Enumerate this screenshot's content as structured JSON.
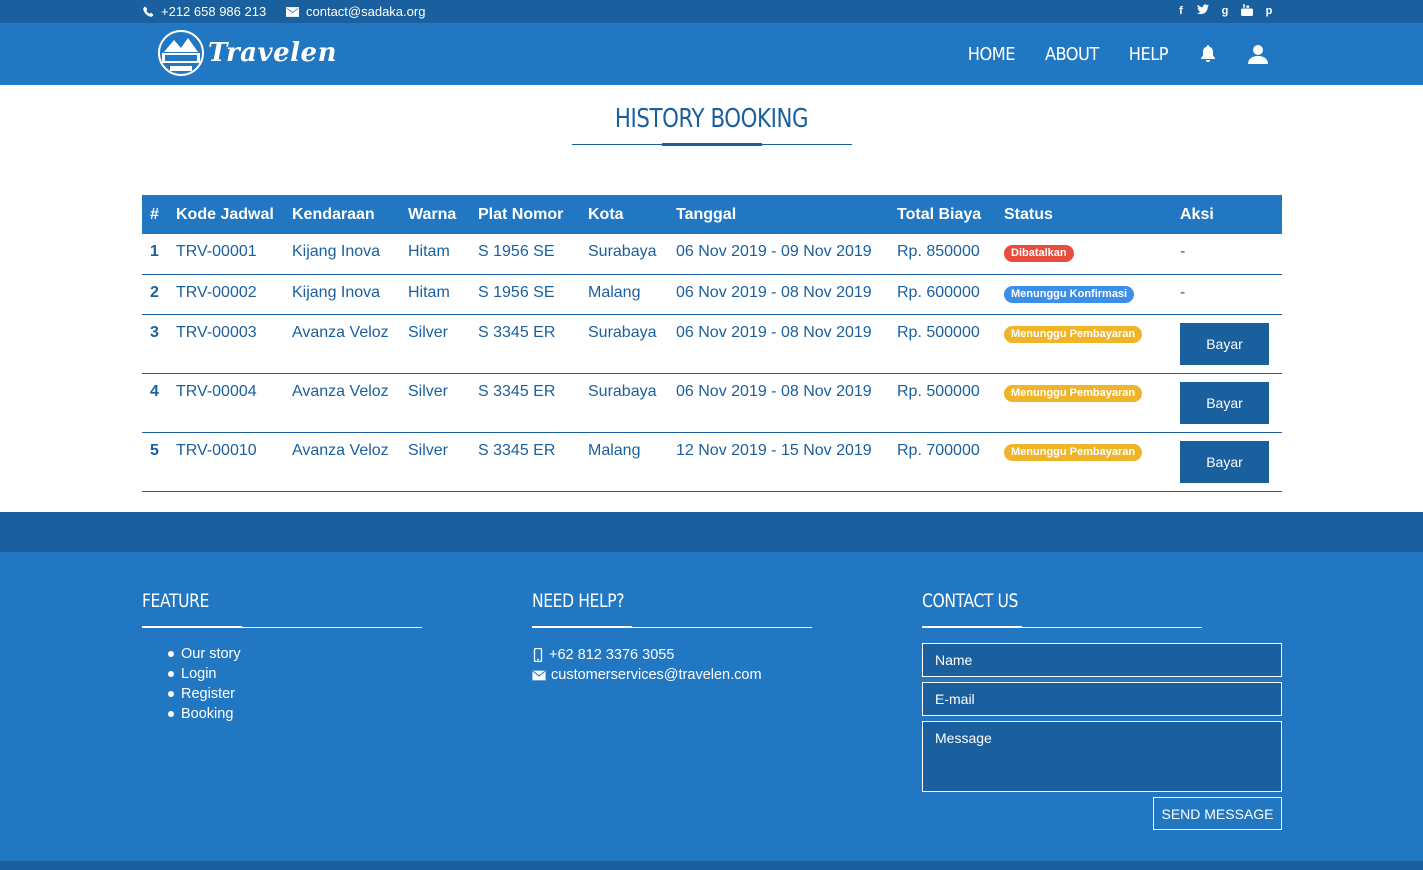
{
  "topbar": {
    "phone": "+212 658 986 213",
    "email": "contact@sadaka.org",
    "social": [
      "facebook-icon",
      "twitter-icon",
      "google-plus-icon",
      "youtube-icon",
      "pinterest-icon"
    ]
  },
  "navbar": {
    "brand": "Travelen",
    "links": [
      "HOME",
      "ABOUT",
      "HELP"
    ],
    "icons": [
      "bell-icon",
      "user-icon"
    ]
  },
  "page": {
    "title": "HISTORY BOOKING"
  },
  "table": {
    "headers": [
      "#",
      "Kode Jadwal",
      "Kendaraan",
      "Warna",
      "Plat Nomor",
      "Kota",
      "Tanggal",
      "Total Biaya",
      "Status",
      "Aksi"
    ],
    "rows": [
      {
        "num": "1",
        "kode": "TRV-00001",
        "kendaraan": "Kijang Inova",
        "warna": "Hitam",
        "plat": "S 1956 SE",
        "kota": "Surabaya",
        "tanggal": "06 Nov 2019 - 09 Nov 2019",
        "biaya": "Rp. 850000",
        "status": "Dibatalkan",
        "aksi": "-"
      },
      {
        "num": "2",
        "kode": "TRV-00002",
        "kendaraan": "Kijang Inova",
        "warna": "Hitam",
        "plat": "S 1956 SE",
        "kota": "Malang",
        "tanggal": "06 Nov 2019 - 08 Nov 2019",
        "biaya": "Rp. 600000",
        "status": "Menunggu Konfirmasi",
        "aksi": "-"
      },
      {
        "num": "3",
        "kode": "TRV-00003",
        "kendaraan": "Avanza Veloz",
        "warna": "Silver",
        "plat": "S 3345 ER",
        "kota": "Surabaya",
        "tanggal": "06 Nov 2019 - 08 Nov 2019",
        "biaya": "Rp. 500000",
        "status": "Menunggu Pembayaran",
        "aksi": "Bayar"
      },
      {
        "num": "4",
        "kode": "TRV-00004",
        "kendaraan": "Avanza Veloz",
        "warna": "Silver",
        "plat": "S 3345 ER",
        "kota": "Surabaya",
        "tanggal": "06 Nov 2019 - 08 Nov 2019",
        "biaya": "Rp. 500000",
        "status": "Menunggu Pembayaran",
        "aksi": "Bayar"
      },
      {
        "num": "5",
        "kode": "TRV-00010",
        "kendaraan": "Avanza Veloz",
        "warna": "Silver",
        "plat": "S 3345 ER",
        "kota": "Malang",
        "tanggal": "12 Nov 2019 - 15 Nov 2019",
        "biaya": "Rp. 700000",
        "status": "Menunggu Pembayaran",
        "aksi": "Bayar"
      }
    ]
  },
  "footer": {
    "feature": {
      "title": "FEATURE",
      "items": [
        "Our story",
        "Login",
        "Register",
        "Booking"
      ]
    },
    "help": {
      "title": "NEED HELP?",
      "phone": "+62 812 3376 3055",
      "email": "customerservices@travelen.com"
    },
    "contact": {
      "title": "CONTACT US",
      "name_placeholder": "Name",
      "email_placeholder": "E-mail",
      "message_placeholder": "Message",
      "send_label": "SEND MESSAGE"
    }
  },
  "colors": {
    "primary": "#2177c2",
    "dark": "#1a5f9e",
    "status_cancelled": "#e74c3c",
    "status_confirm": "#3b8fe8",
    "status_payment": "#f0b429"
  }
}
